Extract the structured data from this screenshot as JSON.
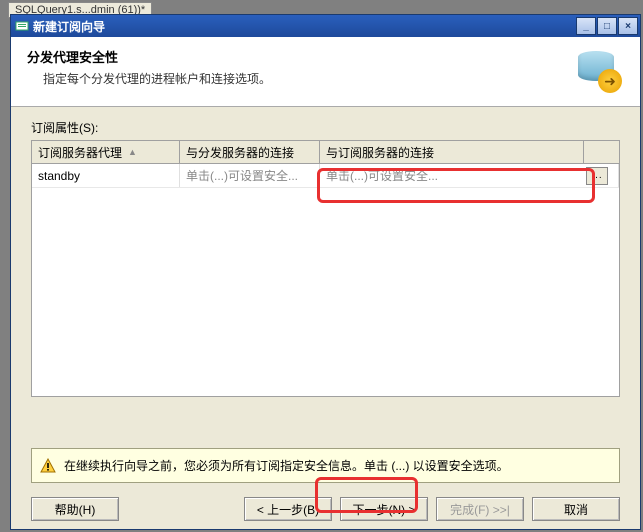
{
  "bg_tab": "SQLQuery1.s...dmin (61))*",
  "titlebar": {
    "title": "新建订阅向导",
    "min": "_",
    "max": "□",
    "close": "×"
  },
  "header": {
    "title": "分发代理安全性",
    "subtitle": "指定每个分发代理的进程帐户和连接选项。"
  },
  "section_label": "订阅属性(S):",
  "columns": {
    "c1": "订阅服务器代理",
    "c2": "与分发服务器的连接",
    "c3": "与订阅服务器的连接"
  },
  "row": {
    "agent": "standby",
    "dist_conn": "单击(...)可设置安全...",
    "sub_conn": "单击(...)可设置安全...",
    "btn": "..."
  },
  "warning": "在继续执行向导之前，您必须为所有订阅指定安全信息。单击 (...) 以设置安全选项。",
  "buttons": {
    "help": "帮助(H)",
    "back": "< 上一步(B)",
    "next": "下一步(N) >",
    "finish": "完成(F) >>|",
    "cancel": "取消"
  }
}
